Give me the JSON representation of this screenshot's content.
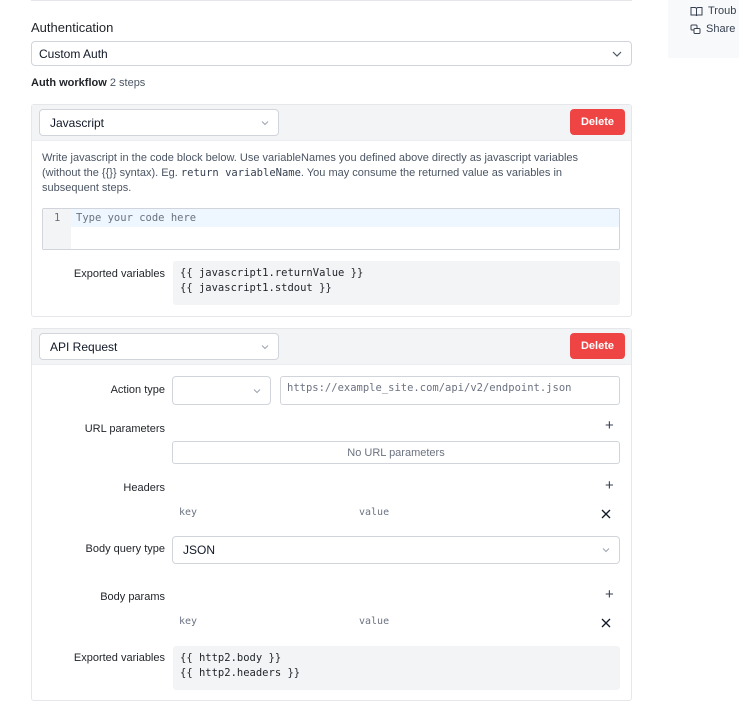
{
  "right_panel": {
    "troubleshoot_label": "Troub",
    "share_label": "Share"
  },
  "authentication": {
    "label": "Authentication",
    "selected": "Custom Auth"
  },
  "workflow": {
    "label": "Auth workflow",
    "steps_count": "2 steps"
  },
  "step1": {
    "type_selected": "Javascript",
    "delete_label": "Delete",
    "description_prefix": "Write javascript in the code block below. Use variableNames you defined above directly as javascript variables (without the {{}} syntax). Eg.",
    "description_code": "return variableName",
    "description_suffix": ". You may consume the returned value as variables in subsequent steps.",
    "editor_line_number": "1",
    "editor_placeholder": "Type your code here",
    "exported_label": "Exported variables",
    "exported_values": "{{ javascript1.returnValue }}\n{{ javascript1.stdout }}"
  },
  "step2": {
    "type_selected": "API Request",
    "delete_label": "Delete",
    "action_type_label": "Action type",
    "action_type_value": "",
    "url_placeholder": "https://example_site.com/api/v2/endpoint.json",
    "url_params_label": "URL parameters",
    "url_params_empty": "No URL parameters",
    "headers_label": "Headers",
    "headers_key_placeholder": "key",
    "headers_value_placeholder": "value",
    "body_query_type_label": "Body query type",
    "body_query_type_value": "JSON",
    "body_params_label": "Body params",
    "body_key_placeholder": "key",
    "body_value_placeholder": "value",
    "exported_label": "Exported variables",
    "exported_values": "{{ http2.body }}\n{{ http2.headers }}"
  },
  "icons": {
    "plus": "+",
    "book": "book-icon",
    "share": "share-icon",
    "chevron": "chevron-down-icon",
    "close": "close-icon"
  },
  "colors": {
    "danger": "#ef4444",
    "card_header": "#f3f4f6",
    "border": "#d1d5db"
  }
}
